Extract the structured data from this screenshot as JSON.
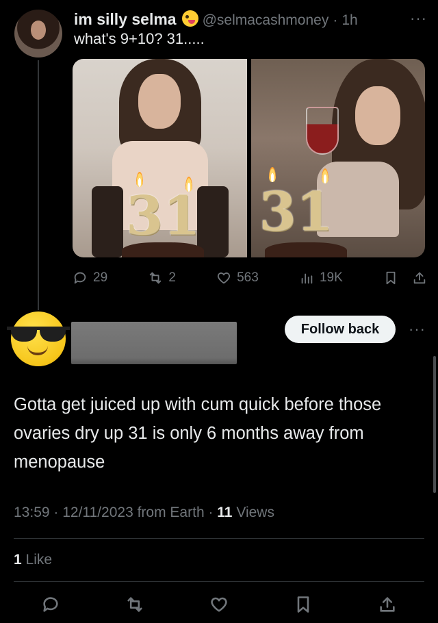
{
  "parent_tweet": {
    "display_name": "im silly selma",
    "handle": "@selmacashmoney",
    "separator": "·",
    "time": "1h",
    "more": "···",
    "text": "what's 9+10? 31.....",
    "media": [
      {
        "candle_text": "31"
      },
      {
        "candle_text": "31"
      }
    ],
    "stats": {
      "replies": "29",
      "retweets": "2",
      "likes": "563",
      "views": "19K"
    }
  },
  "reply": {
    "follow_button": "Follow back",
    "more": "···",
    "text": "Gotta get juiced up with cum quick before those ovaries dry up 31 is only 6 months away from menopause",
    "timestamp": "13:59 · 12/11/2023 from Earth · ",
    "views_count": "11",
    "views_label": " Views",
    "like_count": "1",
    "like_label": " Like"
  },
  "colors": {
    "background": "#000000",
    "text": "#e7e9ea",
    "muted": "#71767b",
    "divider": "#2f3336",
    "follow_button_bg": "#eff3f4"
  },
  "icons": [
    "reply-icon",
    "retweet-icon",
    "like-icon",
    "views-icon",
    "bookmark-icon",
    "share-icon"
  ]
}
